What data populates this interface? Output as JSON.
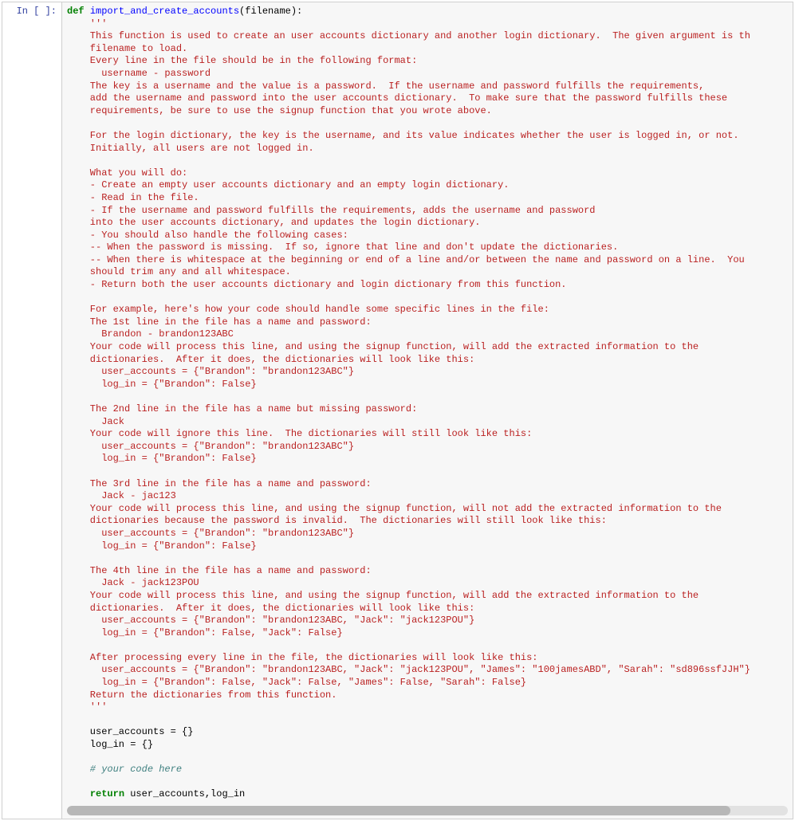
{
  "prompt": "In [ ]:",
  "code": {
    "kw_def": "def",
    "fn_name": "import_and_create_accounts",
    "sig_rest": "(filename):",
    "doc_open": "    '''",
    "docstring": "    This function is used to create an user accounts dictionary and another login dictionary.  The given argument is th\n    filename to load.\n    Every line in the file should be in the following format:\n      username - password\n    The key is a username and the value is a password.  If the username and password fulfills the requirements,\n    add the username and password into the user accounts dictionary.  To make sure that the password fulfills these\n    requirements, be sure to use the signup function that you wrote above.\n\n    For the login dictionary, the key is the username, and its value indicates whether the user is logged in, or not.\n    Initially, all users are not logged in.\n\n    What you will do:\n    - Create an empty user accounts dictionary and an empty login dictionary.\n    - Read in the file.\n    - If the username and password fulfills the requirements, adds the username and password\n    into the user accounts dictionary, and updates the login dictionary.\n    - You should also handle the following cases:\n    -- When the password is missing.  If so, ignore that line and don't update the dictionaries.\n    -- When there is whitespace at the beginning or end of a line and/or between the name and password on a line.  You\n    should trim any and all whitespace.\n    - Return both the user accounts dictionary and login dictionary from this function.\n\n    For example, here's how your code should handle some specific lines in the file:\n    The 1st line in the file has a name and password:\n      Brandon - brandon123ABC\n    Your code will process this line, and using the signup function, will add the extracted information to the\n    dictionaries.  After it does, the dictionaries will look like this:\n      user_accounts = {\"Brandon\": \"brandon123ABC\"}\n      log_in = {\"Brandon\": False}\n\n    The 2nd line in the file has a name but missing password:\n      Jack\n    Your code will ignore this line.  The dictionaries will still look like this:\n      user_accounts = {\"Brandon\": \"brandon123ABC\"}\n      log_in = {\"Brandon\": False}\n\n    The 3rd line in the file has a name and password:\n      Jack - jac123\n    Your code will process this line, and using the signup function, will not add the extracted information to the\n    dictionaries because the password is invalid.  The dictionaries will still look like this:\n      user_accounts = {\"Brandon\": \"brandon123ABC\"}\n      log_in = {\"Brandon\": False}\n\n    The 4th line in the file has a name and password:\n      Jack - jack123POU\n    Your code will process this line, and using the signup function, will add the extracted information to the\n    dictionaries.  After it does, the dictionaries will look like this:\n      user_accounts = {\"Brandon\": \"brandon123ABC, \"Jack\": \"jack123POU\"}\n      log_in = {\"Brandon\": False, \"Jack\": False}\n\n    After processing every line in the file, the dictionaries will look like this:\n      user_accounts = {\"Brandon\": \"brandon123ABC, \"Jack\": \"jack123POU\", \"James\": \"100jamesABD\", \"Sarah\": \"sd896ssfJJH\"}\n      log_in = {\"Brandon\": False, \"Jack\": False, \"James\": False, \"Sarah\": False}\n    Return the dictionaries from this function.",
    "doc_close": "    '''",
    "body1": "    user_accounts = {}",
    "body2": "    log_in = {}",
    "comment": "    # your code here",
    "kw_return": "return",
    "return_indent": "    ",
    "return_rest": " user_accounts,log_in"
  }
}
